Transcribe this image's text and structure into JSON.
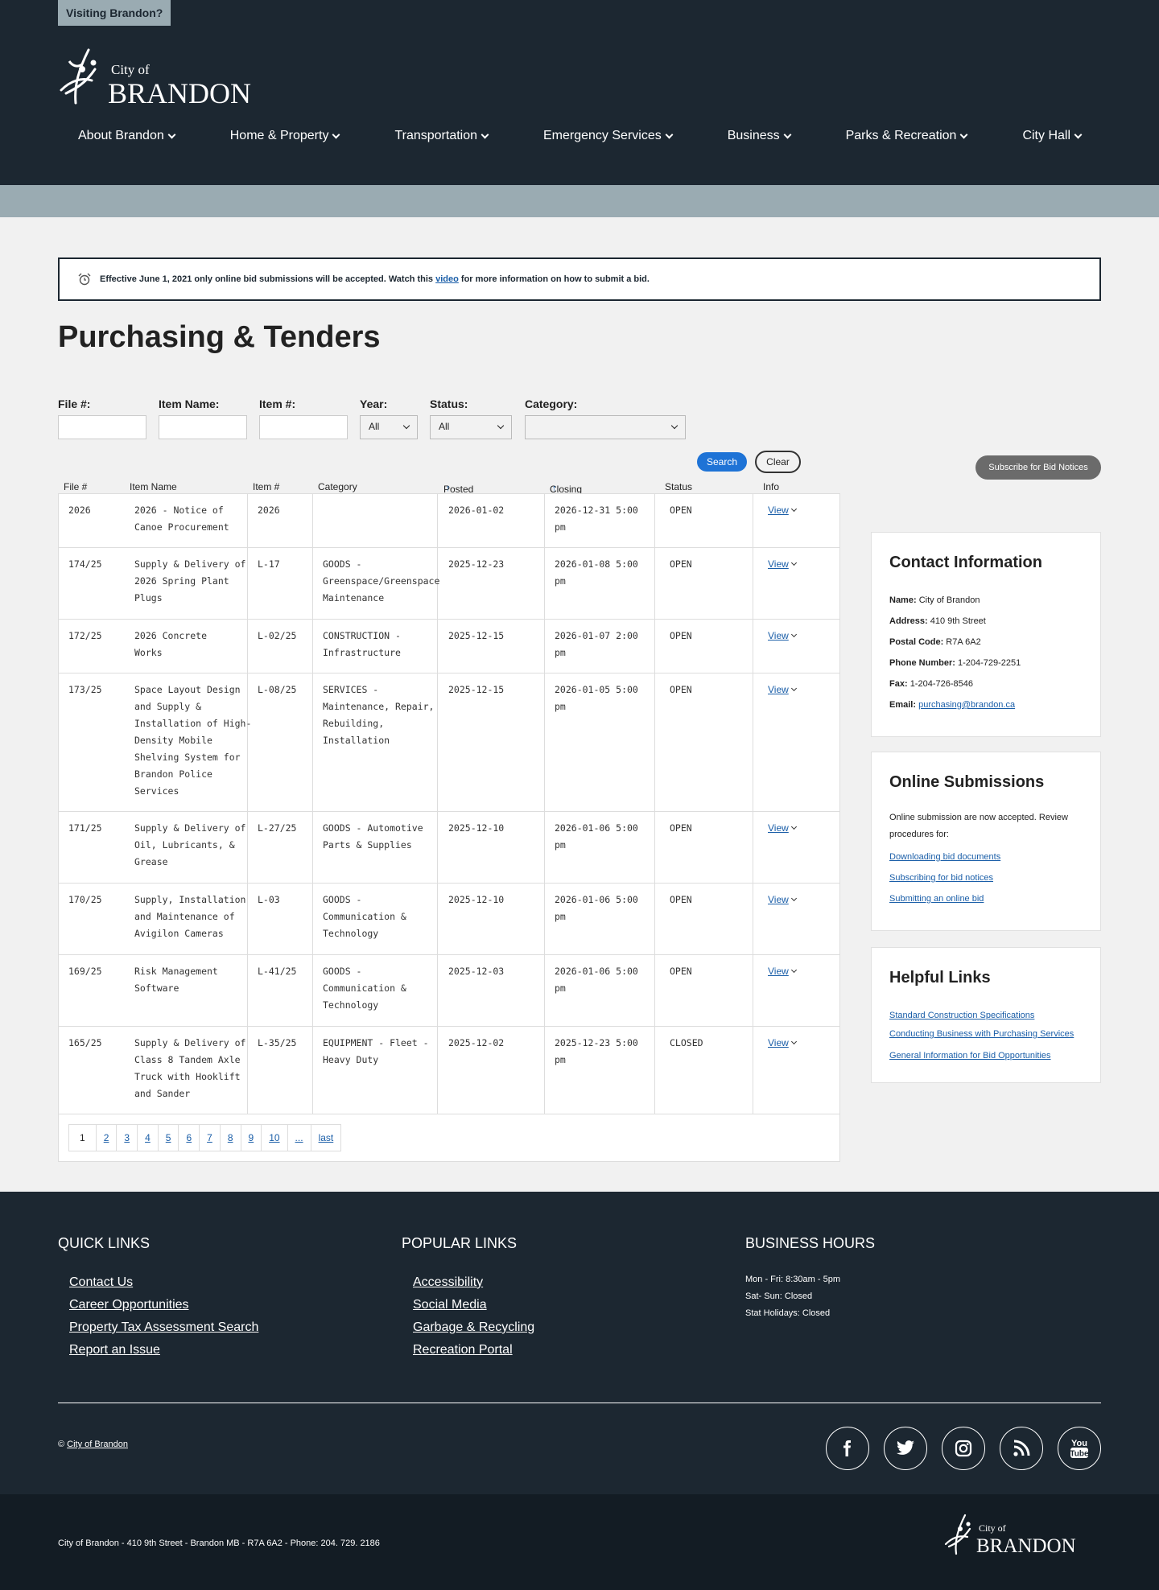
{
  "header": {
    "visiting": "Visiting Brandon?",
    "logo_small": "City of",
    "logo_big": "BRANDON",
    "nav": [
      {
        "label": "About Brandon"
      },
      {
        "label": "Home & Property"
      },
      {
        "label": "Transportation"
      },
      {
        "label": "Emergency Services"
      },
      {
        "label": "Business"
      },
      {
        "label": "Parks & Recreation"
      },
      {
        "label": "City Hall"
      }
    ]
  },
  "notice": {
    "before": "Effective June 1, 2021 only online bid submissions will be accepted. Watch this ",
    "link": "video",
    "after": " for more information on how to submit a bid."
  },
  "page_title": "Purchasing & Tenders",
  "filters": {
    "file_label": "File #:",
    "item_name_label": "Item Name:",
    "item_num_label": "Item #:",
    "year_label": "Year:",
    "year_value": "All",
    "status_label": "Status:",
    "status_value": "All",
    "category_label": "Category:",
    "category_value": "",
    "search": "Search",
    "clear": "Clear"
  },
  "subscribe": "Subscribe for Bid Notices",
  "table": {
    "headers": {
      "file": "File #",
      "item_name": "Item Name",
      "item_num": "Item #",
      "category": "Category",
      "posted": "Posted Date",
      "closing": "Closing Date",
      "status": "Status",
      "info": "Info",
      "sort_arrow": "↑"
    },
    "view_label": "View",
    "rows": [
      {
        "file": "2026",
        "name": [
          "2026 - Notice of",
          "Canoe Procurement"
        ],
        "item": "2026",
        "category": [],
        "posted": "2026-01-02",
        "closing": [
          "2026-12-31 5:00",
          "pm"
        ],
        "status": "OPEN"
      },
      {
        "file": "174/25",
        "name": [
          "Supply & Delivery of",
          "2026 Spring Plant",
          "Plugs"
        ],
        "item": "L-17",
        "category": [
          "GOODS -",
          "Greenspace/Greenspace",
          "Maintenance"
        ],
        "posted": "2025-12-23",
        "closing": [
          "2026-01-08 5:00",
          "pm"
        ],
        "status": "OPEN"
      },
      {
        "file": "172/25",
        "name": [
          "2026 Concrete",
          "Works"
        ],
        "item": "L-02/25",
        "category": [
          "CONSTRUCTION -",
          "Infrastructure"
        ],
        "posted": "2025-12-15",
        "closing": [
          "2026-01-07 2:00",
          "pm"
        ],
        "status": "OPEN"
      },
      {
        "file": "173/25",
        "name": [
          "Space Layout Design",
          "and Supply &",
          "Installation of High-",
          "Density Mobile",
          "Shelving System for",
          "Brandon Police",
          "Services"
        ],
        "item": "L-08/25",
        "category": [
          "SERVICES -",
          "Maintenance, Repair,",
          "Rebuilding,",
          "Installation"
        ],
        "posted": "2025-12-15",
        "closing": [
          "2026-01-05 5:00",
          "pm"
        ],
        "status": "OPEN"
      },
      {
        "file": "171/25",
        "name": [
          "Supply & Delivery of",
          "Oil, Lubricants, &",
          "Grease"
        ],
        "item": "L-27/25",
        "category": [
          "GOODS - Automotive",
          "Parts & Supplies"
        ],
        "posted": "2025-12-10",
        "closing": [
          "2026-01-06 5:00",
          "pm"
        ],
        "status": "OPEN"
      },
      {
        "file": "170/25",
        "name": [
          "Supply, Installation",
          "and Maintenance of",
          "Avigilon Cameras"
        ],
        "item": "L-03",
        "category": [
          "GOODS -",
          "Communication &",
          "Technology"
        ],
        "posted": "2025-12-10",
        "closing": [
          "2026-01-06 5:00",
          "pm"
        ],
        "status": "OPEN"
      },
      {
        "file": "169/25",
        "name": [
          "Risk Management",
          "Software"
        ],
        "item": "L-41/25",
        "category": [
          "GOODS -",
          "Communication &",
          "Technology"
        ],
        "posted": "2025-12-03",
        "closing": [
          "2026-01-06 5:00",
          "pm"
        ],
        "status": "OPEN"
      },
      {
        "file": "165/25",
        "name": [
          "Supply & Delivery of",
          "Class 8 Tandem Axle",
          "Truck with Hooklift",
          "and Sander"
        ],
        "item": "L-35/25",
        "category": [
          "EQUIPMENT - Fleet -",
          "Heavy Duty"
        ],
        "posted": "2025-12-02",
        "closing": [
          "2025-12-23 5:00",
          "pm"
        ],
        "status": "CLOSED"
      }
    ],
    "pages": [
      "1",
      "2",
      "3",
      "4",
      "5",
      "6",
      "7",
      "8",
      "9",
      "10",
      "...",
      "last"
    ]
  },
  "contact": {
    "title": "Contact Information",
    "name_label": "Name:",
    "name": "City of Brandon",
    "address_label": "Address:",
    "address": "410 9th Street",
    "postal_label": "Postal Code:",
    "postal": "R7A 6A2",
    "phone_label": "Phone Number:",
    "phone": "1-204-729-2251",
    "fax_label": "Fax:",
    "fax": "1-204-726-8546",
    "email_label": "Email:",
    "email": "purchasing@brandon.ca"
  },
  "online": {
    "title": "Online Submissions",
    "text": "Online submission are now accepted. Review procedures for:",
    "links": [
      "Downloading bid documents",
      "Subscribing for bid notices",
      "Submitting an online bid"
    ]
  },
  "helpful": {
    "title": "Helpful Links",
    "links": [
      "Standard Construction Specifications",
      "Conducting Business with Purchasing Services",
      "General Information for Bid Opportunities"
    ]
  },
  "footer": {
    "quick_title": "QUICK LINKS",
    "quick": [
      "Contact Us",
      "Career Opportunities",
      "Property Tax Assessment Search",
      "Report an Issue"
    ],
    "popular_title": "POPULAR LINKS",
    "popular": [
      "Accessibility",
      "Social Media",
      "Garbage & Recycling",
      "Recreation Portal"
    ],
    "hours_title": "BUSINESS HOURS",
    "hours": [
      "Mon - Fri: 8:30am - 5pm",
      "Sat- Sun: Closed",
      "Stat Holidays: Closed"
    ],
    "copy_symbol": "©",
    "copy_link": "City of Brandon",
    "address": "City of Brandon - 410 9th Street - Brandon MB - R7A 6A2 - Phone: 204. 729. 2186",
    "socials": [
      "facebook-icon",
      "twitter-icon",
      "instagram-icon",
      "rss-icon",
      "youtube-icon"
    ],
    "youtube_top": "You",
    "youtube_bottom": "Tube"
  }
}
